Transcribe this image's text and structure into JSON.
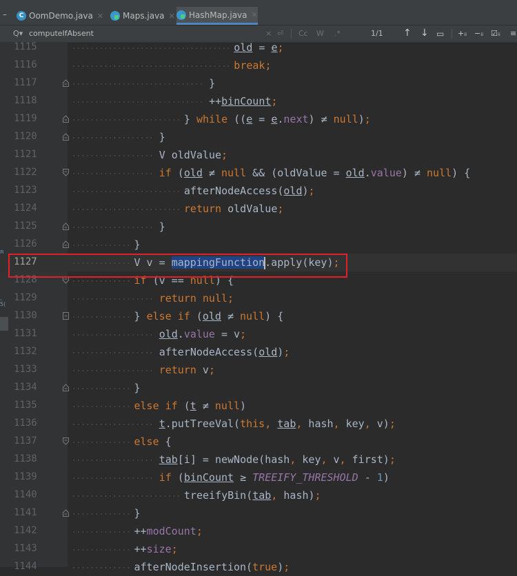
{
  "tabs": [
    {
      "name": "OomDemo.java",
      "icon": "class-c-icon",
      "active": false
    },
    {
      "name": "Maps.java",
      "icon": "class-with-main-icon",
      "active": false
    },
    {
      "name": "HashMap.java",
      "icon": "class-with-main-icon",
      "active": true
    }
  ],
  "search": {
    "query": "computeIfAbsent",
    "match_count": "1/1",
    "options": [
      "×",
      "⏎",
      "Cc",
      "W",
      ".*"
    ]
  },
  "editor": {
    "current_line": "1127",
    "highlighted_term": "mappingFunction",
    "lines": [
      {
        "n": "1115",
        "code": "old = e;"
      },
      {
        "n": "1116",
        "code": "break;"
      },
      {
        "n": "1117",
        "code": "}"
      },
      {
        "n": "1118",
        "code": "++binCount;"
      },
      {
        "n": "1119",
        "code": "} while ((e = e.next) ≠ null);"
      },
      {
        "n": "1120",
        "code": "}"
      },
      {
        "n": "1121",
        "code": "V oldValue;"
      },
      {
        "n": "1122",
        "code": "if (old ≠ null && (oldValue = old.value) ≠ null) {"
      },
      {
        "n": "1123",
        "code": "afterNodeAccess(old);"
      },
      {
        "n": "1124",
        "code": "return oldValue;"
      },
      {
        "n": "1125",
        "code": "}"
      },
      {
        "n": "1126",
        "code": "}"
      },
      {
        "n": "1127",
        "code": "V v = mappingFunction.apply(key);"
      },
      {
        "n": "1128",
        "code": "if (v == null) {"
      },
      {
        "n": "1129",
        "code": "return null;"
      },
      {
        "n": "1130",
        "code": "} else if (old ≠ null) {"
      },
      {
        "n": "1131",
        "code": "old.value = v;"
      },
      {
        "n": "1132",
        "code": "afterNodeAccess(old);"
      },
      {
        "n": "1133",
        "code": "return v;"
      },
      {
        "n": "1134",
        "code": "}"
      },
      {
        "n": "1135",
        "code": "else if (t ≠ null)"
      },
      {
        "n": "1136",
        "code": "t.putTreeVal(this, tab, hash, key, v);"
      },
      {
        "n": "1137",
        "code": "else {"
      },
      {
        "n": "1138",
        "code": "tab[i] = newNode(hash, key, v, first);"
      },
      {
        "n": "1139",
        "code": "if (binCount ≥ TREEIFY_THRESHOLD - 1)"
      },
      {
        "n": "1140",
        "code": "treeifyBin(tab, hash);"
      },
      {
        "n": "1141",
        "code": "}"
      },
      {
        "n": "1142",
        "code": "++modCount;"
      },
      {
        "n": "1143",
        "code": "++size;"
      },
      {
        "n": "1144",
        "code": "afterNodeInsertion(true);"
      }
    ]
  },
  "colors": {
    "keyword": "#cc7832",
    "field": "#9876aa",
    "number": "#6897bb",
    "text": "#a9b7c6",
    "highlight_box": "#e0202a",
    "search_highlight": "#214283"
  }
}
